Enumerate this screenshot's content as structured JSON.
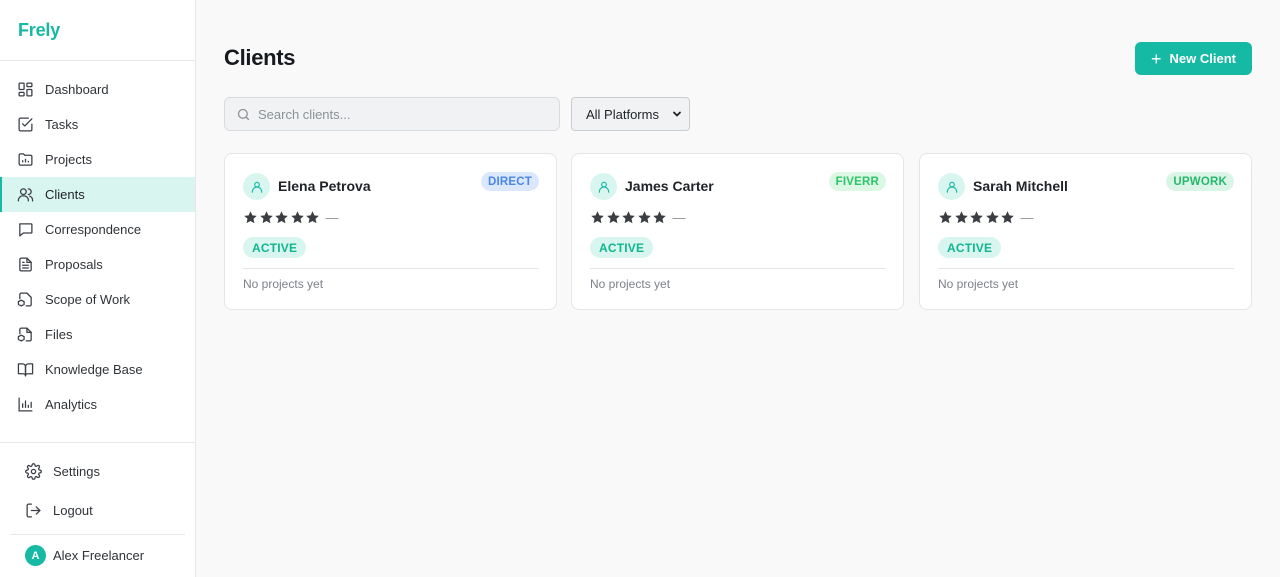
{
  "app": {
    "name": "Frely"
  },
  "sidebar": {
    "items": [
      {
        "label": "Dashboard",
        "icon": "dashboard-icon"
      },
      {
        "label": "Tasks",
        "icon": "tasks-icon"
      },
      {
        "label": "Projects",
        "icon": "folder-icon"
      },
      {
        "label": "Clients",
        "icon": "users-icon",
        "active": true
      },
      {
        "label": "Correspondence",
        "icon": "chat-icon"
      },
      {
        "label": "Proposals",
        "icon": "document-icon"
      },
      {
        "label": "Scope of Work",
        "icon": "scope-icon"
      },
      {
        "label": "Files",
        "icon": "files-icon"
      },
      {
        "label": "Knowledge Base",
        "icon": "book-icon"
      },
      {
        "label": "Analytics",
        "icon": "analytics-icon"
      }
    ],
    "settings_label": "Settings",
    "logout_label": "Logout",
    "user": {
      "initial": "A",
      "name": "Alex Freelancer"
    }
  },
  "main": {
    "title": "Clients",
    "new_button_label": "New Client",
    "search_placeholder": "Search clients...",
    "platform_filter": "All Platforms",
    "clients": [
      {
        "name": "Elena Petrova",
        "platform": "DIRECT",
        "platform_bg": "#dbe8fb",
        "platform_fg": "#4a86e8",
        "rating_text": "—",
        "status": "ACTIVE",
        "projects": "No projects yet"
      },
      {
        "name": "James Carter",
        "platform": "FIVERR",
        "platform_bg": "#dcf7e3",
        "platform_fg": "#2fc36a",
        "rating_text": "—",
        "status": "ACTIVE",
        "projects": "No projects yet"
      },
      {
        "name": "Sarah Mitchell",
        "platform": "UPWORK",
        "platform_bg": "#daf5e6",
        "platform_fg": "#27b86e",
        "rating_text": "—",
        "status": "ACTIVE",
        "projects": "No projects yet"
      }
    ]
  },
  "colors": {
    "accent": "#16b9a3",
    "accent_light": "#d9f5ef"
  }
}
